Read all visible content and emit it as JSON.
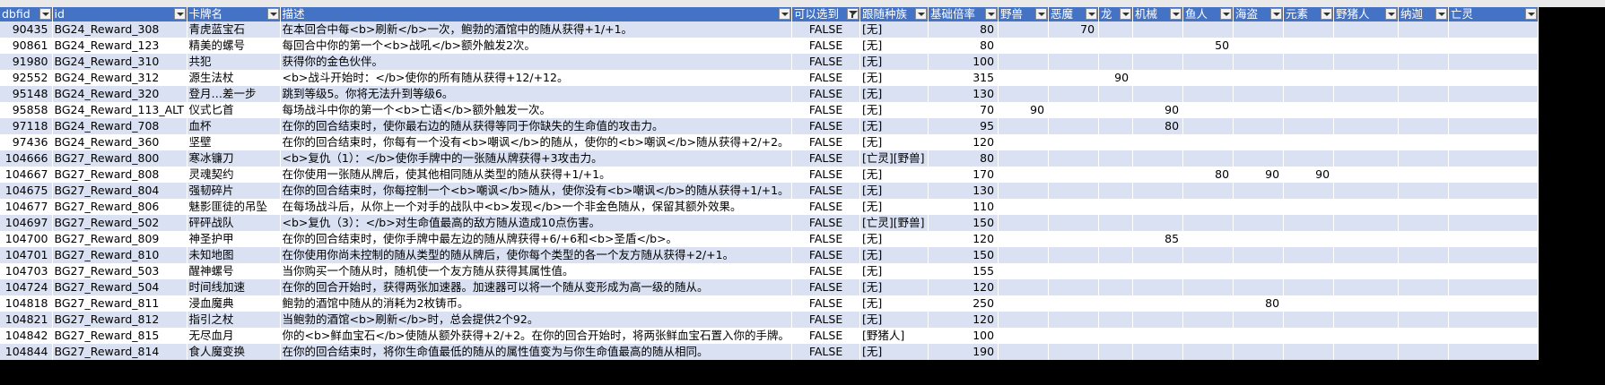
{
  "columns": [
    {
      "key": "dbfid",
      "label": "dbfid",
      "width": 58
    },
    {
      "key": "id",
      "label": "id",
      "width": 150
    },
    {
      "key": "name",
      "label": "卡牌名",
      "width": 104
    },
    {
      "key": "desc",
      "label": "描述",
      "width": 524
    },
    {
      "key": "choose",
      "label": "可以选到",
      "width": 76
    },
    {
      "key": "tribe",
      "label": "跟随种族",
      "width": 76
    },
    {
      "key": "mult",
      "label": "基础倍率",
      "width": 78
    },
    {
      "key": "beast",
      "label": "野兽",
      "width": 56
    },
    {
      "key": "demon",
      "label": "恶魔",
      "width": 56
    },
    {
      "key": "dragon",
      "label": "龙",
      "width": 38
    },
    {
      "key": "mech",
      "label": "机械",
      "width": 56
    },
    {
      "key": "murloc",
      "label": "鱼人",
      "width": 56
    },
    {
      "key": "pirate",
      "label": "海盗",
      "width": 56
    },
    {
      "key": "elemental",
      "label": "元素",
      "width": 56
    },
    {
      "key": "quilboar",
      "label": "野猪人",
      "width": 72
    },
    {
      "key": "naga",
      "label": "纳迦",
      "width": 56
    },
    {
      "key": "undead",
      "label": "亡灵",
      "width": 100
    }
  ],
  "filter_active_column": "choose",
  "rows": [
    {
      "dbfid": "90435",
      "id": "BG24_Reward_308",
      "name": "青虎蓝宝石",
      "desc": "在本回合中每<b>刷新</b>一次，鲍勃的酒馆中的随从获得+1/+1。",
      "choose": "FALSE",
      "tribe": "[无]",
      "mult": "80",
      "demon": "70"
    },
    {
      "dbfid": "90861",
      "id": "BG24_Reward_123",
      "name": "精美的螺号",
      "desc": "每回合中你的第一个<b>战吼</b>额外触发2次。",
      "choose": "FALSE",
      "tribe": "[无]",
      "mult": "80",
      "murloc": "50"
    },
    {
      "dbfid": "91980",
      "id": "BG24_Reward_310",
      "name": "共犯",
      "desc": "获得你的金色伙伴。",
      "choose": "FALSE",
      "tribe": "[无]",
      "mult": "100"
    },
    {
      "dbfid": "92552",
      "id": "BG24_Reward_312",
      "name": "源生法杖",
      "desc": "<b>战斗开始时：</b>使你的所有随从获得+12/+12。",
      "choose": "FALSE",
      "tribe": "[无]",
      "mult": "315",
      "dragon": "90"
    },
    {
      "dbfid": "95148",
      "id": "BG24_Reward_320",
      "name": "登月…差一步",
      "desc": "跳到等级5。你将无法升到等级6。",
      "choose": "FALSE",
      "tribe": "[无]",
      "mult": "130"
    },
    {
      "dbfid": "95858",
      "id": "BG24_Reward_113_ALT",
      "name": "仪式匕首",
      "desc": "每场战斗中你的第一个<b>亡语</b>额外触发一次。",
      "choose": "FALSE",
      "tribe": "[无]",
      "mult": "70",
      "beast": "90",
      "mech": "90"
    },
    {
      "dbfid": "97118",
      "id": "BG24_Reward_708",
      "name": "血杯",
      "desc": "在你的回合结束时，使你最右边的随从获得等同于你缺失的生命值的攻击力。",
      "choose": "FALSE",
      "tribe": "[无]",
      "mult": "95",
      "mech": "80"
    },
    {
      "dbfid": "97436",
      "id": "BG24_Reward_360",
      "name": "坚壁",
      "desc": "在你的回合结束时，你每有一个没有<b>嘲讽</b>的随从，使你的<b>嘲讽</b>随从获得+2/+2。",
      "choose": "FALSE",
      "tribe": "[无]",
      "mult": "120"
    },
    {
      "dbfid": "104666",
      "id": "BG27_Reward_800",
      "name": "寒冰镰刀",
      "desc": "<b>复仇（1）：</b>使你手牌中的一张随从牌获得+3攻击力。",
      "choose": "FALSE",
      "tribe": "[亡灵][野兽]",
      "mult": "80"
    },
    {
      "dbfid": "104667",
      "id": "BG27_Reward_808",
      "name": "灵魂契约",
      "desc": "在你使用一张随从牌后，使其他相同随从类型的随从获得+1/+1。",
      "choose": "FALSE",
      "tribe": "[无]",
      "mult": "170",
      "murloc": "80",
      "pirate": "90",
      "elemental": "90"
    },
    {
      "dbfid": "104675",
      "id": "BG27_Reward_804",
      "name": "强韧碎片",
      "desc": "在你的回合结束时，你每控制一个<b>嘲讽</b>随从，使你没有<b>嘲讽</b>的随从获得+1/+1。",
      "choose": "FALSE",
      "tribe": "[无]",
      "mult": "130"
    },
    {
      "dbfid": "104677",
      "id": "BG27_Reward_806",
      "name": "魅影匪徒的吊坠",
      "desc": "在每场战斗后，从你上一个对手的战队中<b>发现</b>一个非金色随从，保留其额外效果。",
      "choose": "FALSE",
      "tribe": "[无]",
      "mult": "110"
    },
    {
      "dbfid": "104697",
      "id": "BG27_Reward_502",
      "name": "砰砰战队",
      "desc": "<b>复仇（3）：</b>对生命值最高的敌方随从造成10点伤害。",
      "choose": "FALSE",
      "tribe": "[亡灵][野兽]",
      "mult": "150"
    },
    {
      "dbfid": "104700",
      "id": "BG27_Reward_809",
      "name": "神圣护甲",
      "desc": "在你的回合结束时，使你手牌中最左边的随从牌获得+6/+6和<b>圣盾</b>。",
      "choose": "FALSE",
      "tribe": "[无]",
      "mult": "120",
      "mech": "85"
    },
    {
      "dbfid": "104701",
      "id": "BG27_Reward_810",
      "name": "未知地图",
      "desc": "在你使用你尚未控制的随从类型的随从牌后，使你每个类型的各一个友方随从获得+2/+1。",
      "choose": "FALSE",
      "tribe": "[无]",
      "mult": "150"
    },
    {
      "dbfid": "104703",
      "id": "BG27_Reward_503",
      "name": "醒神螺号",
      "desc": "当你购买一个随从时，随机使一个友方随从获得其属性值。",
      "choose": "FALSE",
      "tribe": "[无]",
      "mult": "155"
    },
    {
      "dbfid": "104724",
      "id": "BG27_Reward_504",
      "name": "时间线加速",
      "desc": "在你的回合开始时，获得两张加速器。加速器可以将一个随从变形成为高一级的随从。",
      "choose": "FALSE",
      "tribe": "[无]",
      "mult": "120"
    },
    {
      "dbfid": "104818",
      "id": "BG27_Reward_811",
      "name": "浸血魔典",
      "desc": "鲍勃的酒馆中随从的消耗为2枚铸币。",
      "choose": "FALSE",
      "tribe": "[无]",
      "mult": "250",
      "pirate": "80"
    },
    {
      "dbfid": "104821",
      "id": "BG27_Reward_812",
      "name": "指引之杖",
      "desc": "当鲍勃的酒馆<b>刷新</b>时，总会提供2个92。",
      "choose": "FALSE",
      "tribe": "[无]",
      "mult": "120"
    },
    {
      "dbfid": "104842",
      "id": "BG27_Reward_815",
      "name": "无尽血月",
      "desc": "你的<b>鲜血宝石</b>使随从额外获得+2/+2。在你的回合开始时，将两张鲜血宝石置入你的手牌。",
      "choose": "FALSE",
      "tribe": "[野猪人]",
      "mult": "100"
    },
    {
      "dbfid": "104844",
      "id": "BG27_Reward_814",
      "name": "食人魔变换",
      "desc": "在你的回合结束时，将你生命值最低的随从的属性值变为与你生命值最高的随从相同。",
      "choose": "FALSE",
      "tribe": "[无]",
      "mult": "190"
    }
  ]
}
